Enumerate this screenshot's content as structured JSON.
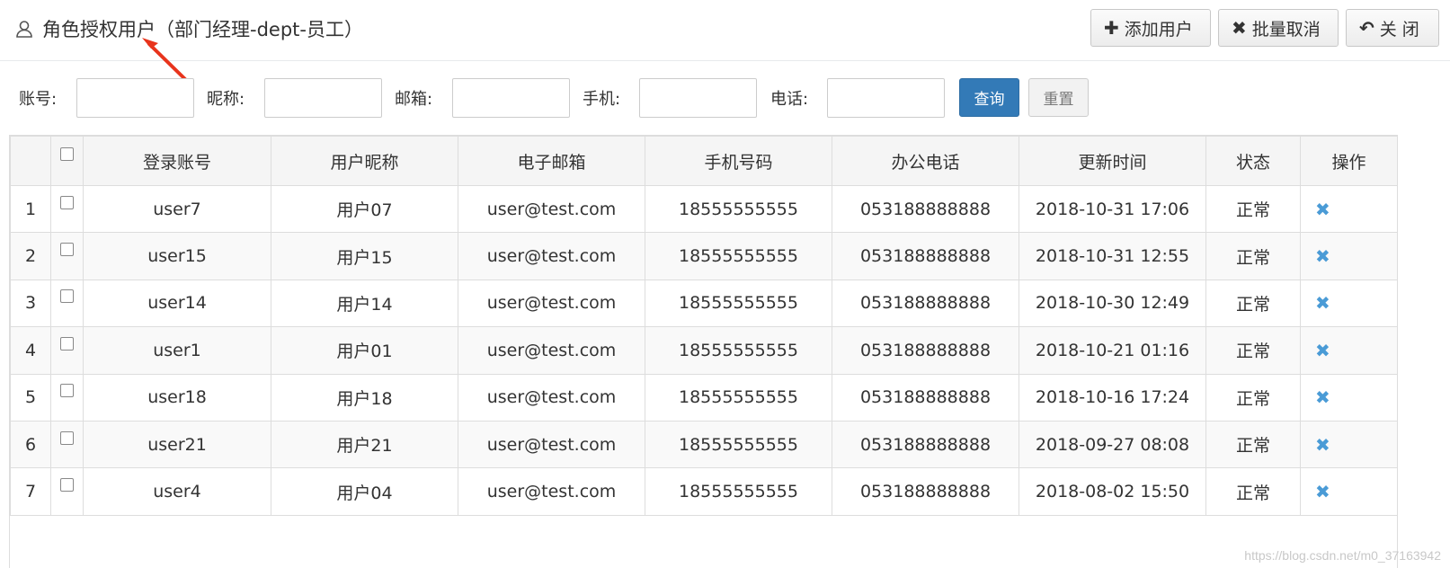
{
  "header": {
    "title": "角色授权用户（部门经理-dept-员工）",
    "buttons": {
      "add": {
        "icon": "plus-icon",
        "glyph": "✚",
        "label": "添加用户"
      },
      "batch_cancel": {
        "icon": "times-icon",
        "glyph": "✖",
        "label": "批量取消"
      },
      "close": {
        "icon": "reply-icon",
        "glyph": "↶",
        "label": "关 闭"
      }
    }
  },
  "search": {
    "account_label": "账号:",
    "nickname_label": "昵称:",
    "email_label": "邮箱:",
    "mobile_label": "手机:",
    "phone_label": "电话:",
    "query_label": "查询",
    "reset_label": "重置"
  },
  "table": {
    "columns": [
      "",
      "",
      "登录账号",
      "用户昵称",
      "电子邮箱",
      "手机号码",
      "办公电话",
      "更新时间",
      "状态",
      "操作"
    ],
    "rows": [
      {
        "no": "1",
        "account": "user7",
        "nickname": "用户07",
        "email": "user@test.com",
        "mobile": "18555555555",
        "phone": "053188888888",
        "updated": "2018-10-31 17:06",
        "status": "正常"
      },
      {
        "no": "2",
        "account": "user15",
        "nickname": "用户15",
        "email": "user@test.com",
        "mobile": "18555555555",
        "phone": "053188888888",
        "updated": "2018-10-31 12:55",
        "status": "正常"
      },
      {
        "no": "3",
        "account": "user14",
        "nickname": "用户14",
        "email": "user@test.com",
        "mobile": "18555555555",
        "phone": "053188888888",
        "updated": "2018-10-30 12:49",
        "status": "正常"
      },
      {
        "no": "4",
        "account": "user1",
        "nickname": "用户01",
        "email": "user@test.com",
        "mobile": "18555555555",
        "phone": "053188888888",
        "updated": "2018-10-21 01:16",
        "status": "正常"
      },
      {
        "no": "5",
        "account": "user18",
        "nickname": "用户18",
        "email": "user@test.com",
        "mobile": "18555555555",
        "phone": "053188888888",
        "updated": "2018-10-16 17:24",
        "status": "正常"
      },
      {
        "no": "6",
        "account": "user21",
        "nickname": "用户21",
        "email": "user@test.com",
        "mobile": "18555555555",
        "phone": "053188888888",
        "updated": "2018-09-27 08:08",
        "status": "正常"
      },
      {
        "no": "7",
        "account": "user4",
        "nickname": "用户04",
        "email": "user@test.com",
        "mobile": "18555555555",
        "phone": "053188888888",
        "updated": "2018-08-02 15:50",
        "status": "正常"
      }
    ],
    "delete_glyph": "✖"
  },
  "watermark": "https://blog.csdn.net/m0_37163942",
  "colors": {
    "primary": "#337ab7",
    "delete_icon": "#4a9bd6",
    "annotation_arrow": "#e8341c"
  }
}
